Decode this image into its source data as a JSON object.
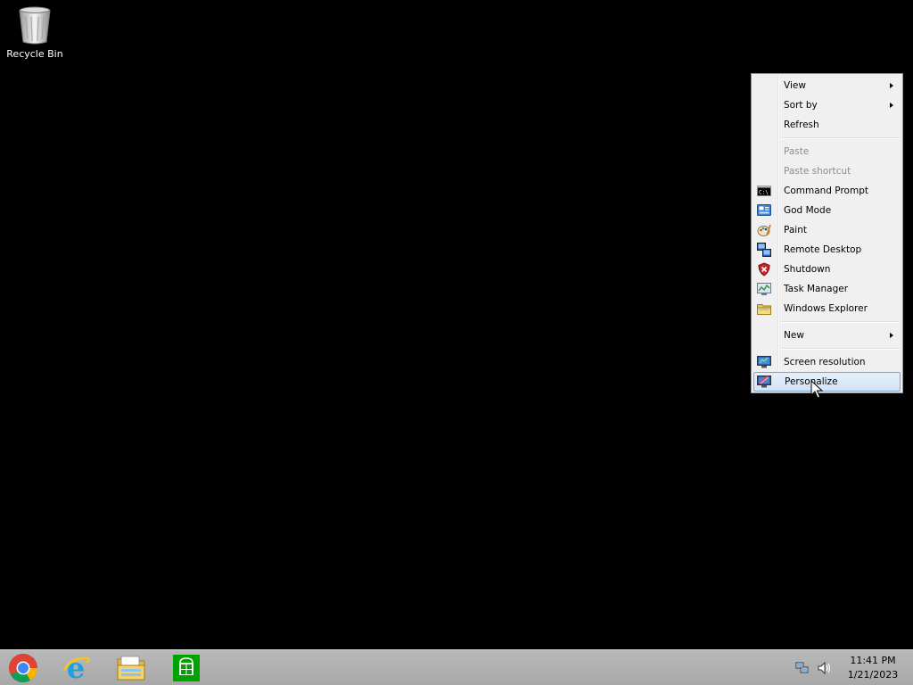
{
  "desktop": {
    "recycle_bin_label": "Recycle Bin",
    "background_color": "#000000"
  },
  "context_menu": {
    "items": [
      {
        "label": "View",
        "submenu": true
      },
      {
        "label": "Sort by",
        "submenu": true
      },
      {
        "label": "Refresh"
      },
      {
        "label": "Paste",
        "disabled": true
      },
      {
        "label": "Paste shortcut",
        "disabled": true
      },
      {
        "label": "Command Prompt",
        "icon": "command-prompt-icon"
      },
      {
        "label": "God Mode",
        "icon": "god-mode-icon"
      },
      {
        "label": "Paint",
        "icon": "paint-icon"
      },
      {
        "label": "Remote Desktop",
        "icon": "remote-desktop-icon"
      },
      {
        "label": "Shutdown",
        "icon": "shutdown-shield-icon"
      },
      {
        "label": "Task Manager",
        "icon": "task-manager-icon"
      },
      {
        "label": "Windows Explorer",
        "icon": "folder-icon"
      },
      {
        "label": "New",
        "submenu": true
      },
      {
        "label": "Screen resolution",
        "icon": "screen-resolution-icon"
      },
      {
        "label": "Personalize",
        "icon": "personalize-icon",
        "highlighted": true
      }
    ],
    "highlight_color": "#d1e4f7"
  },
  "taskbar": {
    "pinned": [
      {
        "name": "Google Chrome",
        "icon": "chrome-icon"
      },
      {
        "name": "Internet Explorer",
        "icon": "internet-explorer-icon"
      },
      {
        "name": "File Explorer",
        "icon": "file-explorer-icon"
      },
      {
        "name": "Store",
        "icon": "store-icon"
      }
    ],
    "tray": {
      "network_icon": "network-icon",
      "volume_icon": "volume-icon"
    },
    "clock": {
      "time": "11:41 PM",
      "date": "1/21/2023"
    }
  }
}
